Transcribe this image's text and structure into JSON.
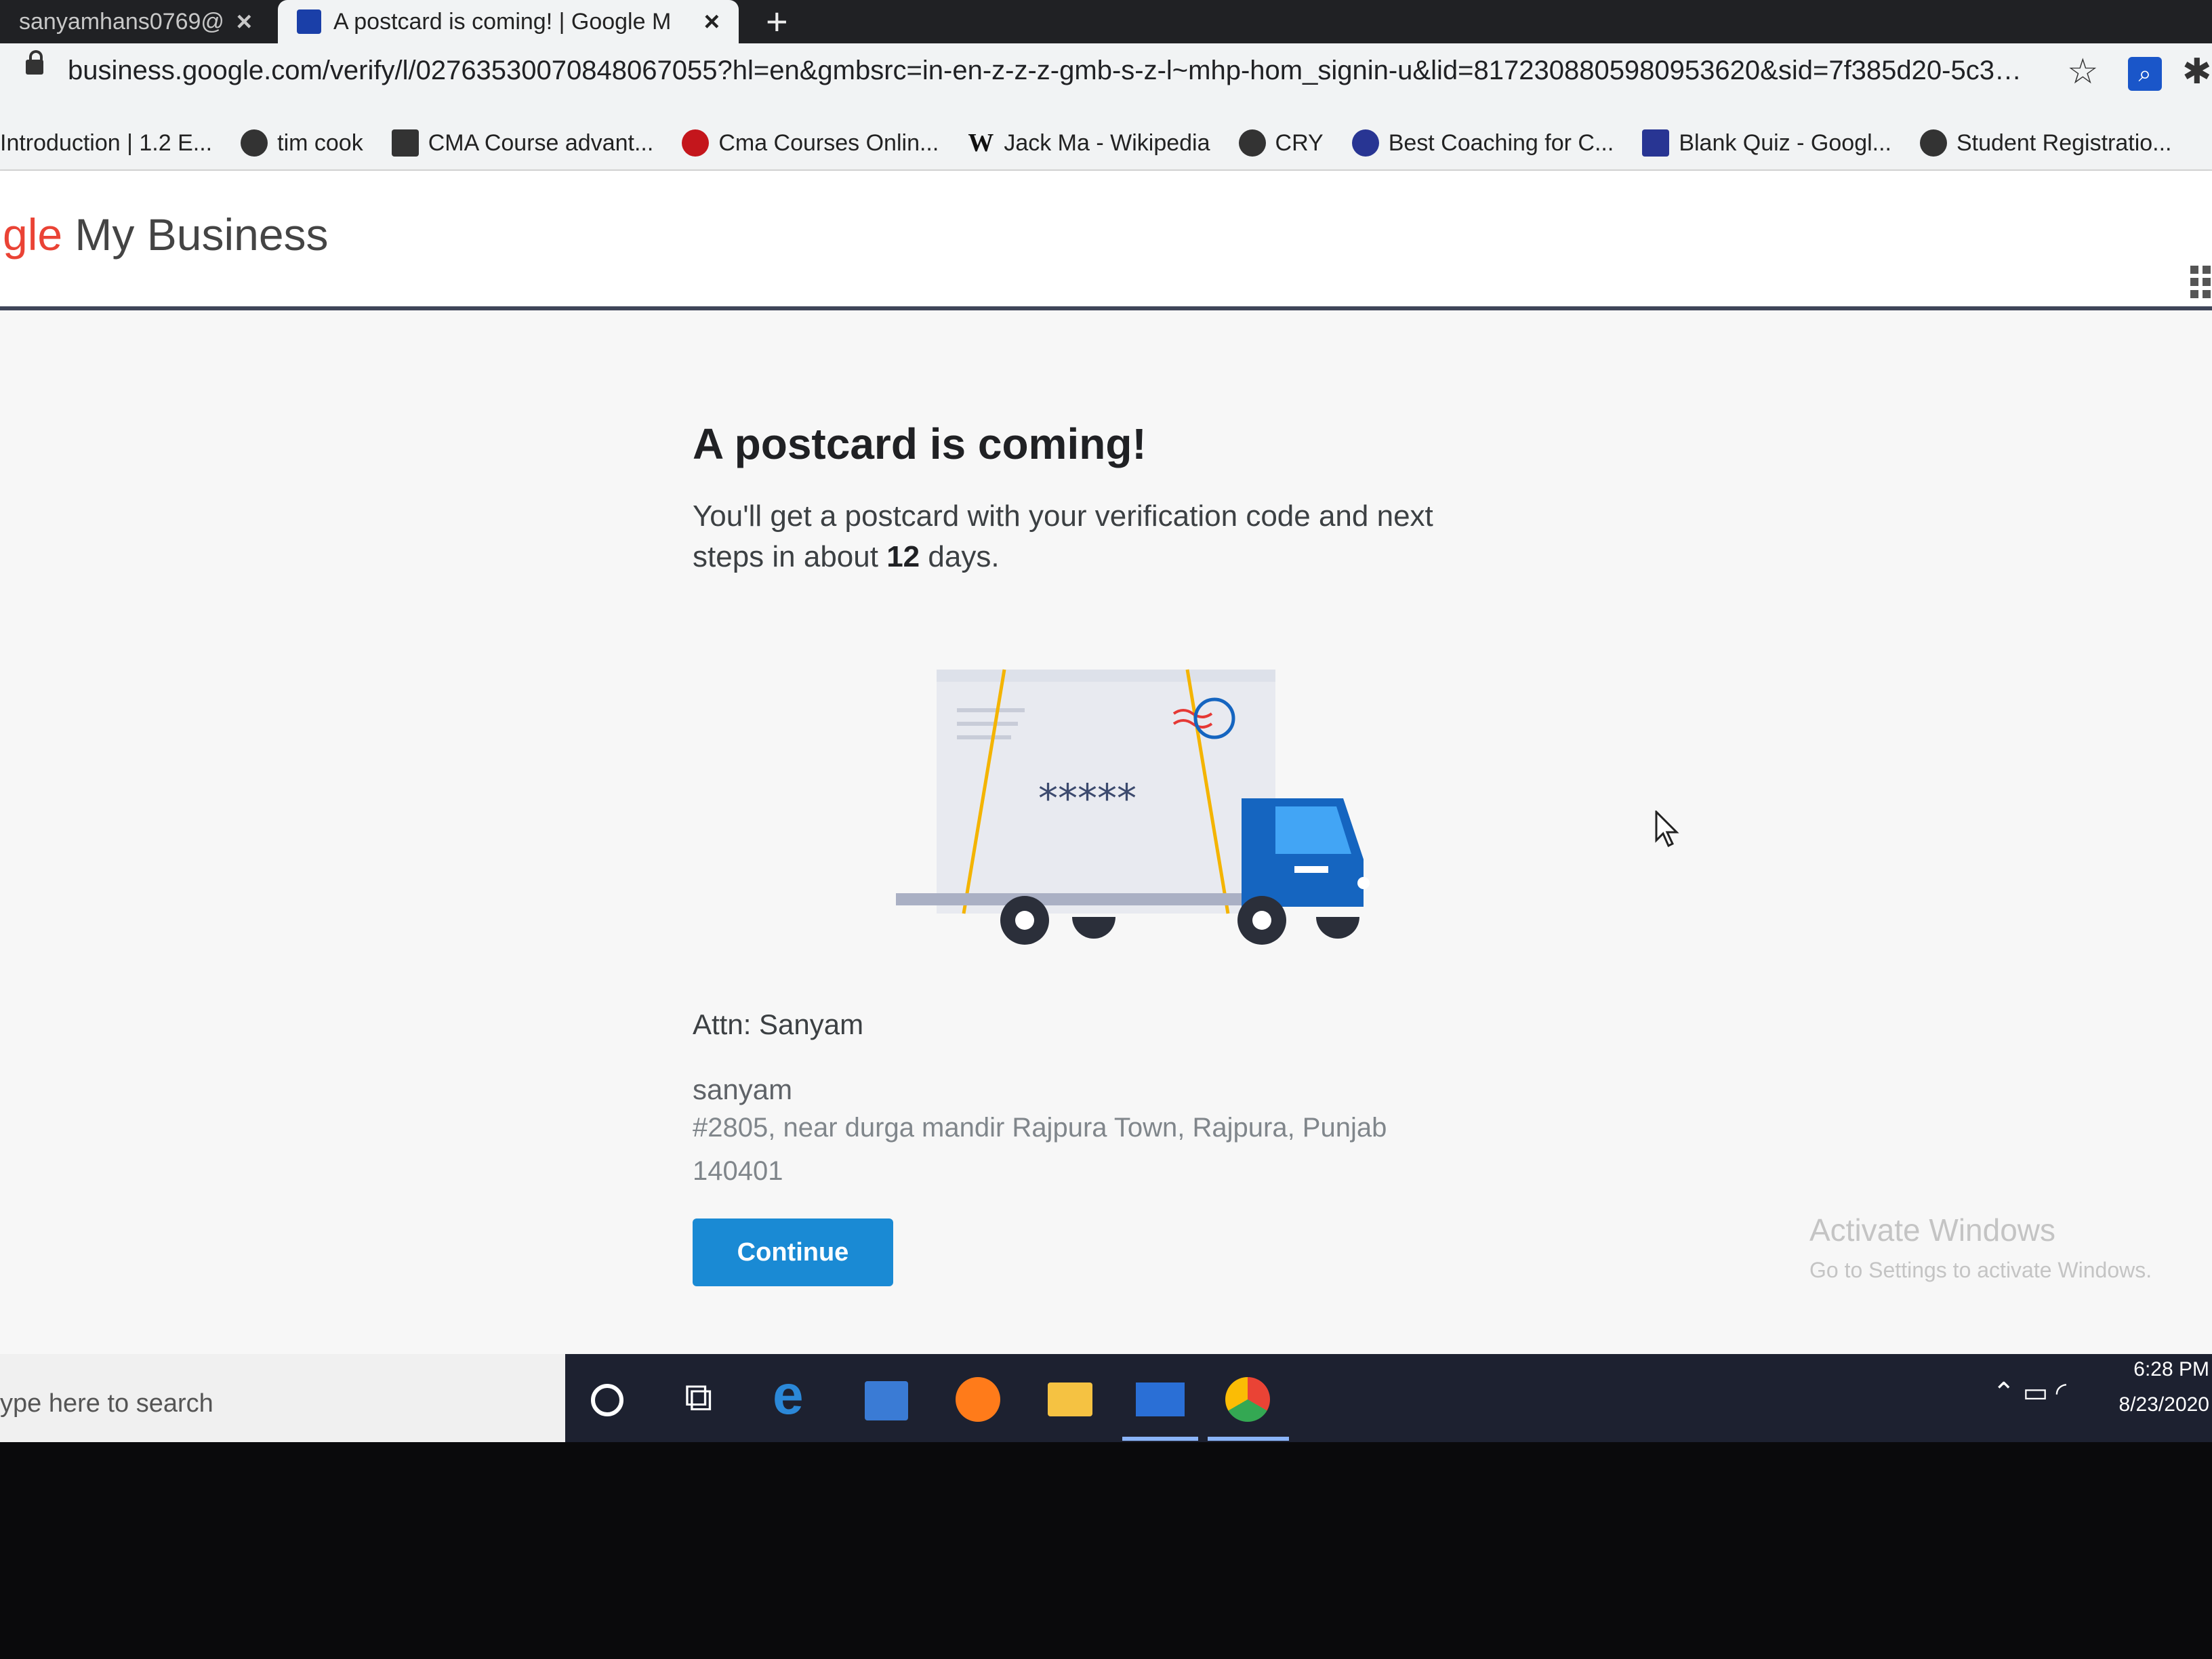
{
  "browser": {
    "tabs": [
      {
        "label": "sanyamhans0769@",
        "active": false
      },
      {
        "label": "A postcard is coming! | Google M",
        "active": true
      }
    ],
    "new_tab_icon": "plus-icon",
    "url": "business.google.com/verify/l/02763530070848067055?hl=en&gmbsrc=in-en-z-z-z-gmb-s-z-l~mhp-hom_signin-u&lid=8172308805980953620&sid=7f385d20-5c35-4...",
    "bookmarks": [
      {
        "label": "Introduction | 1.2 E...",
        "icon": "none"
      },
      {
        "label": "tim cook",
        "icon": "site-icon"
      },
      {
        "label": "CMA Course advant...",
        "icon": "mountain-icon"
      },
      {
        "label": "Cma Courses Onlin...",
        "icon": "arrow-icon"
      },
      {
        "label": "Jack Ma - Wikipedia",
        "icon": "wikipedia-icon"
      },
      {
        "label": "CRY",
        "icon": "site-icon"
      },
      {
        "label": "Best Coaching for C...",
        "icon": "globe-icon"
      },
      {
        "label": "Blank Quiz - Googl...",
        "icon": "forms-icon"
      },
      {
        "label": "Student Registratio...",
        "icon": "globe-icon"
      }
    ]
  },
  "app": {
    "brand_prefix": "gle",
    "brand_rest": " My Business"
  },
  "main": {
    "title": "A postcard is coming!",
    "subtitle_pre": "You'll get a postcard with your verification code and next steps in about ",
    "subtitle_bold": "12",
    "subtitle_post": " days.",
    "illustration_code": "*****",
    "attn": "Attn: Sanyam",
    "recipient": "sanyam",
    "address_line1": "#2805, near durga mandir Rajpura Town, Rajpura, Punjab",
    "address_line2": "140401",
    "continue_label": "Continue"
  },
  "watermark": {
    "line1": "Activate Windows",
    "line2": "Go to Settings to activate Windows."
  },
  "taskbar": {
    "search_placeholder": "ype here to search",
    "time": "6:28 PM",
    "date": "8/23/2020"
  },
  "colors": {
    "accent": "#1a8ad4",
    "truck_blue": "#1565c0",
    "brand_blue": "#4285f4"
  }
}
